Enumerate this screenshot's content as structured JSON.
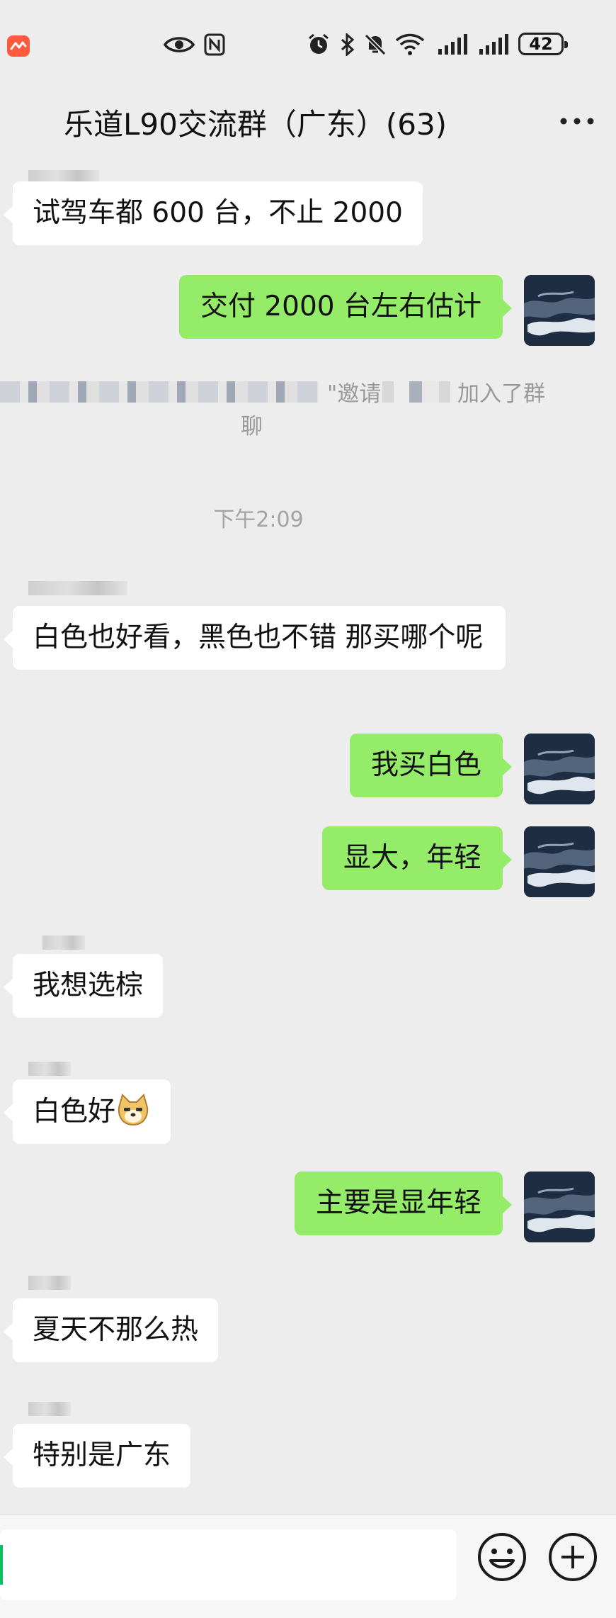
{
  "status_bar": {
    "battery": "42",
    "icons": [
      "app-notification-icon",
      "eye-icon",
      "nfc-icon",
      "alarm-icon",
      "bluetooth-icon",
      "mute-icon",
      "wifi-icon",
      "signal-icon",
      "signal-icon",
      "battery-icon"
    ]
  },
  "header": {
    "title": "乐道L90交流群（广东）(63)",
    "more_icon": "more-dots-icon"
  },
  "messages": [
    {
      "side": "left",
      "text": "试驾车都 600 台，不止 2000"
    },
    {
      "side": "right",
      "text": "交付 2000 台左右估计"
    },
    {
      "type": "system",
      "prefix": "\"邀请",
      "suffix": "加入了群",
      "suffix2": "聊"
    },
    {
      "type": "time",
      "text": "下午2:09"
    },
    {
      "side": "left",
      "text": "白色也好看，黑色也不错 那买哪个呢"
    },
    {
      "side": "right",
      "text": "我买白色"
    },
    {
      "side": "right",
      "text": "显大，年轻"
    },
    {
      "side": "left",
      "text": "我想选棕"
    },
    {
      "side": "left",
      "text": "白色好",
      "emoji": "doge-emoji-icon"
    },
    {
      "side": "right",
      "text": "主要是显年轻"
    },
    {
      "side": "left",
      "text": "夏天不那么热"
    },
    {
      "side": "left",
      "text": "特别是广东"
    }
  ],
  "input_bar": {
    "input_value": "",
    "emoji_button": "smiley-icon",
    "more_button": "plus-circle-icon"
  },
  "colors": {
    "background": "#ededed",
    "bubble_self": "#95ec69",
    "bubble_other": "#ffffff",
    "accent": "#07c160"
  }
}
